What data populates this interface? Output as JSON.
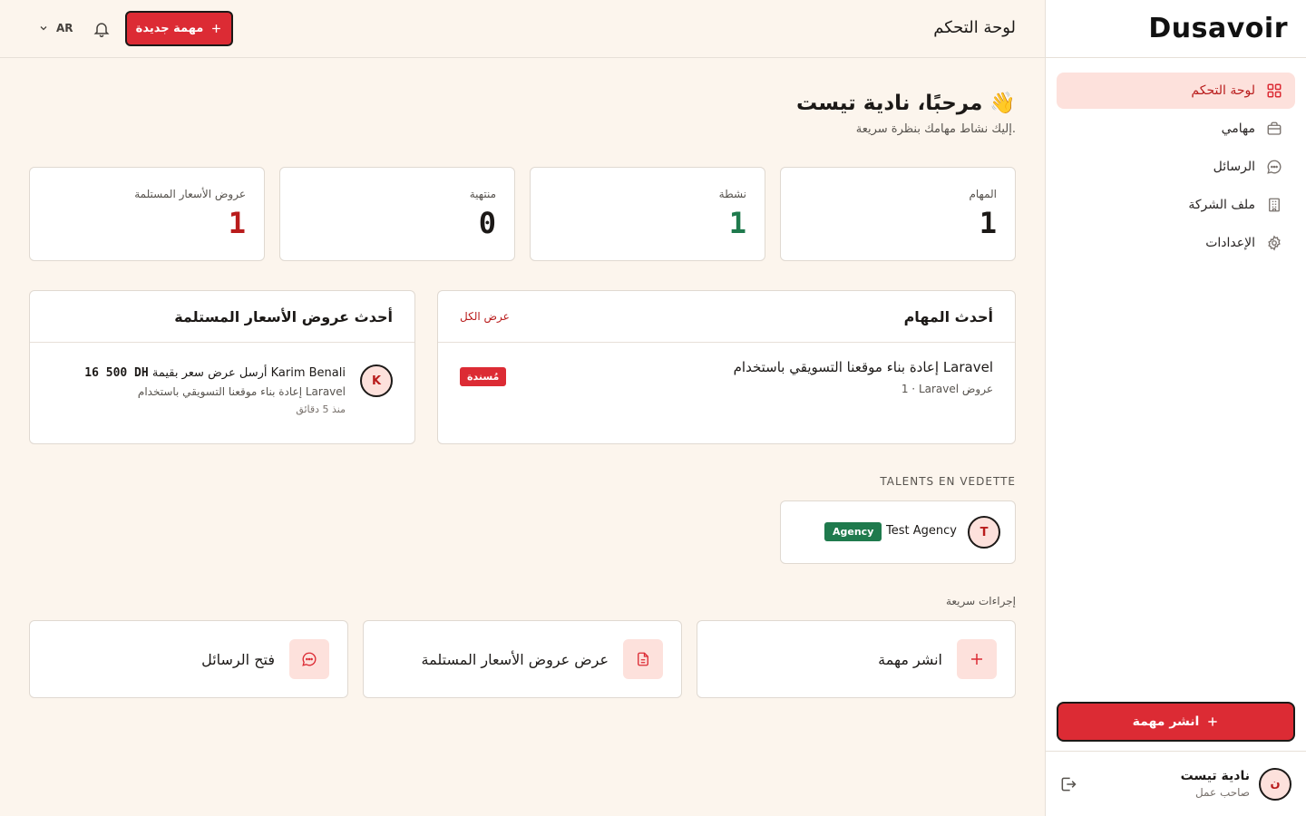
{
  "brand": {
    "name": "Dusavoir"
  },
  "topbar": {
    "title": "لوحة التحكم",
    "new_task_label": "مهمة جديدة",
    "lang": "AR"
  },
  "sidebar": {
    "items": [
      {
        "label": "لوحة التحكم",
        "icon": "grid-icon",
        "active": true
      },
      {
        "label": "مهامي",
        "icon": "briefcase-icon",
        "active": false
      },
      {
        "label": "الرسائل",
        "icon": "chat-icon",
        "active": false
      },
      {
        "label": "ملف الشركة",
        "icon": "building-icon",
        "active": false
      },
      {
        "label": "الإعدادات",
        "icon": "gear-icon",
        "active": false
      }
    ],
    "cta_label": "انشر مهمة",
    "user": {
      "name": "نادية تيست",
      "role": "صاحب عمل",
      "initial": "ن"
    }
  },
  "welcome": {
    "title": "مرحبًا، نادية تيست 👋",
    "subtitle": "إليك نشاط مهامك بنظرة سريعة."
  },
  "stats": [
    {
      "label": "المهام",
      "value": "1",
      "color": "#1c1917"
    },
    {
      "label": "نشطة",
      "value": "1",
      "color": "#1f7a4d"
    },
    {
      "label": "منتهية",
      "value": "0",
      "color": "#1c1917"
    },
    {
      "label": "عروض الأسعار المستلمة",
      "value": "1",
      "color": "#b91c1c"
    }
  ],
  "recent_tasks": {
    "title": "أحدث المهام",
    "view_all": "عرض الكل",
    "items": [
      {
        "title": "إعادة بناء موقعنا التسويقي باستخدام Laravel",
        "meta": "1 · Laravel عروض",
        "status": "مُسندة"
      }
    ]
  },
  "recent_quotes": {
    "title": "أحدث عروض الأسعار المستلمة",
    "items": [
      {
        "initial": "K",
        "sender": "Karim Benali",
        "text": "أرسل عرض سعر بقيمة",
        "amount": "16 500 DH",
        "task": "إعادة بناء موقعنا التسويقي باستخدام Laravel",
        "time": "منذ 5 دقائق"
      }
    ]
  },
  "featured": {
    "label": "TALENTS EN VEDETTE",
    "items": [
      {
        "initial": "T",
        "name": "Test Agency",
        "badge": "Agency"
      }
    ]
  },
  "quick_actions": {
    "label": "إجراءات سريعة",
    "items": [
      {
        "label": "انشر مهمة",
        "icon": "plus-icon"
      },
      {
        "label": "عرض عروض الأسعار المستلمة",
        "icon": "document-icon"
      },
      {
        "label": "فتح الرسائل",
        "icon": "chat-icon"
      }
    ]
  },
  "colors": {
    "accent": "#dc2b34",
    "accent_soft": "#fde1dc",
    "green": "#1f7a4d",
    "background": "#fcf5ed"
  }
}
